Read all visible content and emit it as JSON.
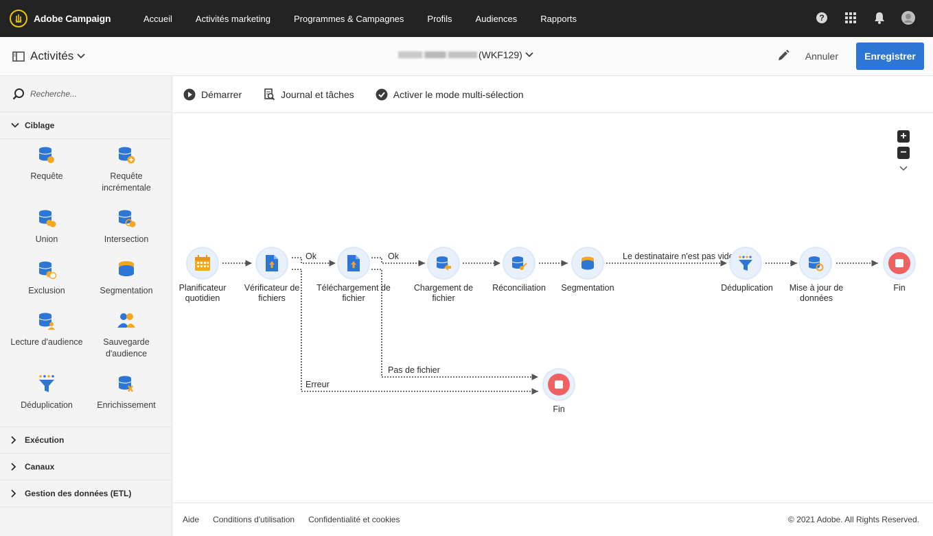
{
  "topnav": {
    "brand": "Adobe Campaign",
    "items": [
      "Accueil",
      "Activités marketing",
      "Programmes & Campagnes",
      "Profils",
      "Audiences",
      "Rapports"
    ],
    "icons": [
      "help-icon",
      "apps-grid-icon",
      "bell-icon",
      "avatar-icon"
    ]
  },
  "header": {
    "section_title": "Activités",
    "workflow_id": "(WKF129)",
    "cancel_label": "Annuler",
    "save_label": "Enregistrer"
  },
  "sidebar": {
    "search_placeholder": "Recherche...",
    "categories": [
      {
        "label": "Ciblage",
        "expanded": true,
        "tiles": [
          "Requête",
          "Requête incrémentale",
          "Union",
          "Intersection",
          "Exclusion",
          "Segmentation",
          "Lecture d'audience",
          "Sauvegarde d'audience",
          "Déduplication",
          "Enrichissement"
        ]
      },
      {
        "label": "Exécution",
        "expanded": false
      },
      {
        "label": "Canaux",
        "expanded": false
      },
      {
        "label": "Gestion des données (ETL)",
        "expanded": false
      }
    ]
  },
  "toolbar": {
    "start": "Démarrer",
    "logs": "Journal et tâches",
    "multiselect": "Activer le mode multi-sélection"
  },
  "workflow": {
    "nodes": [
      "Planificateur quotidien",
      "Vérificateur de fichiers",
      "Téléchargement de fichier",
      "Chargement de fichier",
      "Réconciliation",
      "Segmentation",
      "Déduplication",
      "Mise à jour de données",
      "Fin",
      "Fin"
    ],
    "transitions": [
      "Ok",
      "Ok",
      "Le destinataire n'est pas vide",
      "Pas de fichier",
      "Erreur"
    ]
  },
  "footer": {
    "help": "Aide",
    "terms": "Conditions d'utilisation",
    "privacy": "Confidentialité et cookies",
    "copyright": "© 2021 Adobe. All Rights Reserved."
  },
  "colors": {
    "topnav_bg": "#232323",
    "accent": "#2d76d6",
    "node_bg": "#e7f0fb",
    "end_node": "#ef6262",
    "orange": "#f5a623"
  }
}
